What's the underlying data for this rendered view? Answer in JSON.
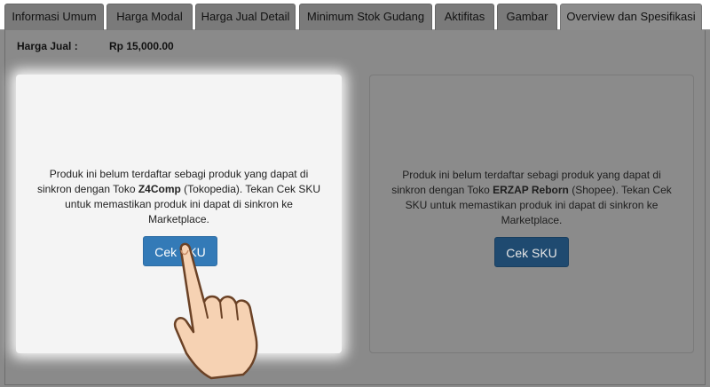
{
  "tabs": [
    {
      "label": "Informasi Umum"
    },
    {
      "label": "Harga Modal"
    },
    {
      "label": "Harga Jual Detail"
    },
    {
      "label": "Minimum Stok Gudang"
    },
    {
      "label": "Aktifitas"
    },
    {
      "label": "Gambar"
    },
    {
      "label": "Overview dan Spesifikasi"
    }
  ],
  "price": {
    "label": "Harga Jual :",
    "value": "Rp 15,000.00"
  },
  "cards": [
    {
      "text_before": "Produk ini belum terdaftar sebagi produk yang dapat di sinkron dengan Toko ",
      "store": "Z4Comp",
      "text_after": " (Tokopedia). Tekan Cek SKU untuk memastikan produk ini dapat di sinkron ke Marketplace.",
      "button": "Cek SKU"
    },
    {
      "text_before": "Produk ini belum terdaftar sebagi produk yang dapat di sinkron dengan Toko ",
      "store": "ERZAP Reborn",
      "text_after": " (Shopee). Tekan Cek SKU untuk memastikan produk ini dapat di sinkron ke Marketplace.",
      "button": "Cek SKU"
    }
  ],
  "colors": {
    "primary_button": "#337ab7",
    "overlay": "#8a8a8a",
    "highlight_card": "#f4f4f4"
  },
  "icons": {
    "pointer": "pointing-hand-icon"
  }
}
